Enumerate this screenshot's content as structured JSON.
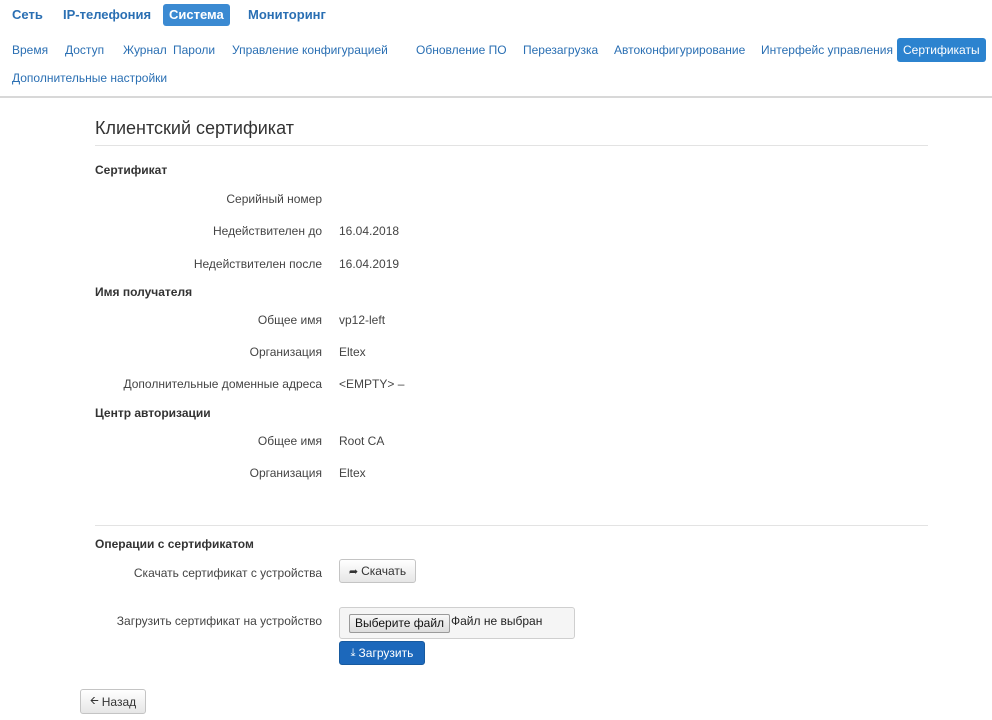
{
  "top_nav": [
    "Сеть",
    "IP-телефония",
    "Система",
    "Мониторинг"
  ],
  "top_nav_active": "Система",
  "sub_nav": [
    "Время",
    "Доступ",
    "Журнал",
    "Пароли",
    "Управление конфигурацией",
    "Обновление ПО",
    "Перезагрузка",
    "Автоконфигурирование",
    "Интерфейс управления",
    "Сертификаты",
    "Дополнительные настройки"
  ],
  "sub_nav_active": "Сертификаты",
  "page_title": "Клиентский сертификат",
  "certificate": {
    "heading": "Сертификат",
    "serial_label": "Серийный номер",
    "serial_value": "",
    "not_before_label": "Недействителен до",
    "not_before_value": "16.04.2018",
    "not_after_label": "Недействителен после",
    "not_after_value": "16.04.2019"
  },
  "subject": {
    "heading": "Имя получателя",
    "cn_label": "Общее имя",
    "cn_value": "vp12-left",
    "org_label": "Организация",
    "org_value": "Eltex",
    "san_label": "Дополнительные доменные адреса",
    "san_value": "<EMPTY> –"
  },
  "issuer": {
    "heading": "Центр авторизации",
    "cn_label": "Общее имя",
    "cn_value": "Root CA",
    "org_label": "Организация",
    "org_value": "Eltex"
  },
  "operations": {
    "heading": "Операции с сертификатом",
    "download_label": "Скачать сертификат с устройства",
    "download_button": "Скачать",
    "upload_label": "Загрузить сертификат на устройство",
    "choose_file_button": "Выберите файл",
    "file_status": "Файл не выбран",
    "upload_button": "Загрузить"
  },
  "back_button": "Назад",
  "colors": {
    "accent": "#2c83cf",
    "link": "#2a6fb3",
    "primary_button": "#1c68bb"
  },
  "icons": {
    "download": "share-arrow-icon",
    "upload": "upload-icon",
    "back": "arrow-left-icon"
  }
}
